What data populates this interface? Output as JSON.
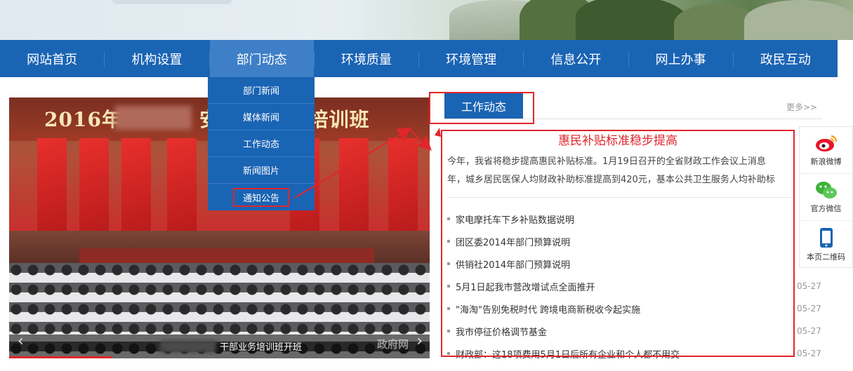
{
  "nav": {
    "items": [
      "网站首页",
      "机构设置",
      "部门动态",
      "环境质量",
      "环境管理",
      "信息公开",
      "网上办事",
      "政民互动"
    ],
    "active": "部门动态"
  },
  "dropdown": {
    "items": [
      "部门新闻",
      "媒体新闻",
      "工作动态",
      "新闻图片",
      "通知公告"
    ]
  },
  "slideshow": {
    "banner_title_left": "2016年",
    "banner_title_right": "安监   部业务培训班",
    "caption": "干部业务培训班开班",
    "prev_icon": "‹",
    "next_icon": "›",
    "watermark": "政府网"
  },
  "news": {
    "tab_label": "工作动态",
    "more_link": "更多>>",
    "headline": "惠民补贴标准稳步提高",
    "summary_line1": "今年，我省将稳步提高惠民补贴标准。1月19日召开的全省财政工作会议上消息",
    "summary_line2": "年，城乡居民医保人均财政补助标准提高到420元，基本公共卫生服务人均补助标",
    "items": [
      {
        "title": "家电摩托车下乡补贴数据说明",
        "date": ""
      },
      {
        "title": "团区委2014年部门预算说明",
        "date": ""
      },
      {
        "title": "供销社2014年部门预算说明",
        "date": ""
      },
      {
        "title": "5月1日起我市营改增试点全面推开",
        "date": "05-27"
      },
      {
        "title": "\"海淘\"告别免税时代 跨境电商新税收今起实施",
        "date": "05-27"
      },
      {
        "title": "我市停征价格调节基金",
        "date": "05-27"
      },
      {
        "title": "财政部：这18项费用5月1日后所有企业和个人都不用交",
        "date": "05-27"
      }
    ]
  },
  "share": {
    "items": [
      {
        "label": "新浪微博",
        "icon": "weibo-icon"
      },
      {
        "label": "官方微信",
        "icon": "wechat-icon"
      },
      {
        "label": "本页二维码",
        "icon": "mobile-qr-icon"
      }
    ]
  },
  "colors": {
    "nav_blue": "#1a64b4",
    "accent_red": "#e0262b"
  }
}
